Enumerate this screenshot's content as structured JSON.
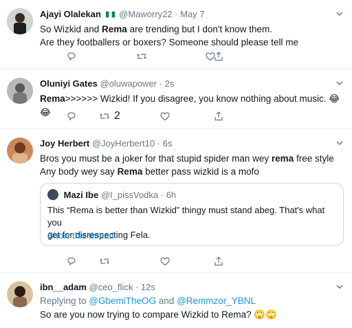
{
  "tweets": [
    {
      "name": "Ajayi Olalekan",
      "handle": "@Maworry22",
      "sep": "·",
      "time": "May 7",
      "line1_a": "So Wizkid and ",
      "line1_b": "Rema",
      "line1_c": " are trending but I don't know them.",
      "line2": "Are they footballers or boxers? Someone should please tell me"
    },
    {
      "name": "Oluniyi Gates",
      "handle": "@oluwapower",
      "sep": "·",
      "time": "2s",
      "text_a": "Rema",
      "text_b": ">>>>>> Wizkid! If you disagree, you know nothing about music. ",
      "emoji": "😂😂",
      "retweet_count": "2"
    },
    {
      "name": "Joy Herbert",
      "handle": "@JoyHerbert10",
      "sep": "·",
      "time": "6s",
      "line1_a": "Bros you must be a joker for that stupid spider man wey ",
      "line1_b": "rema",
      "line1_c": " free style",
      "line2_a": "Any body wey say ",
      "line2_b": "Rema",
      "line2_c": " better pass wizkid is a mofo",
      "quote": {
        "name": "Mazi Ibe",
        "handle": "@I_pissVodka",
        "sep": "·",
        "time": "6h",
        "line1": "This “Rema is better than Wizkid” thingy must stand abeg. That's what you",
        "line2": "get for disrespecting Fela.",
        "show_thread": "Show this thread"
      }
    },
    {
      "name": "ibn__adam",
      "handle": "@ceo_flick",
      "sep": "·",
      "time": "12s",
      "replying_prefix": "Replying to ",
      "reply_user1": "@GbemiTheOG",
      "reply_and": " and ",
      "reply_user2": "@Remmzor_YBNL",
      "text": "So are you now trying to compare Wizkid to Rema? ",
      "emoji": "🙄🙄"
    }
  ],
  "colors": {
    "link": "#1b95e0",
    "meta": "#657786",
    "border": "#e6ecf0"
  }
}
